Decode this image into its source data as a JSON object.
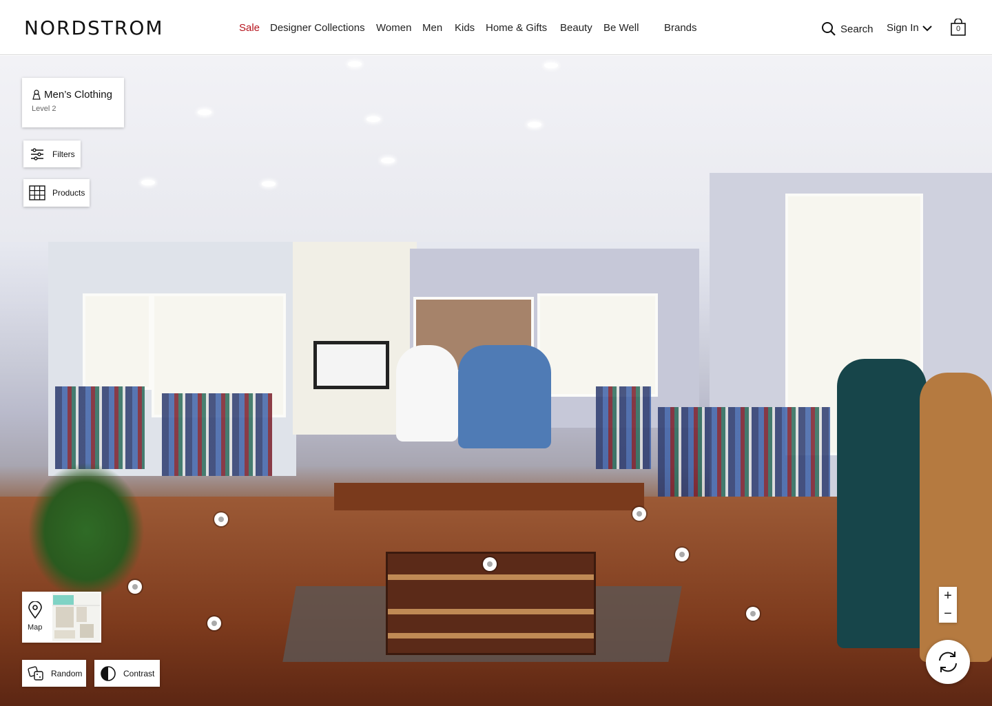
{
  "header": {
    "logo": "NORDSTROM",
    "nav": [
      "Sale",
      "Designer Collections",
      "Women",
      "Men",
      "Kids",
      "Home & Gifts",
      "Beauty",
      "Be Well",
      "Brands"
    ],
    "search_label": "Search",
    "signin_label": "Sign In",
    "bag_count": "0"
  },
  "location": {
    "title": "Men’s Clothing",
    "level": "Level 2"
  },
  "controls": {
    "filters": "Filters",
    "products": "Products",
    "map": "Map",
    "random": "Random",
    "contrast": "Contrast",
    "zoom_in": "+",
    "zoom_out": "−"
  },
  "colors": {
    "sale": "#b5121b",
    "text": "#1b1b1b"
  },
  "icons": {
    "search": "search-icon",
    "chevron": "chevron-down-icon",
    "bag": "shopping-bag-icon",
    "location": "person-pin-icon",
    "filters": "sliders-icon",
    "products": "grid-icon",
    "map": "map-pin-icon",
    "random": "dice-icon",
    "contrast": "contrast-icon",
    "rotate": "rotate-arrows-icon"
  }
}
